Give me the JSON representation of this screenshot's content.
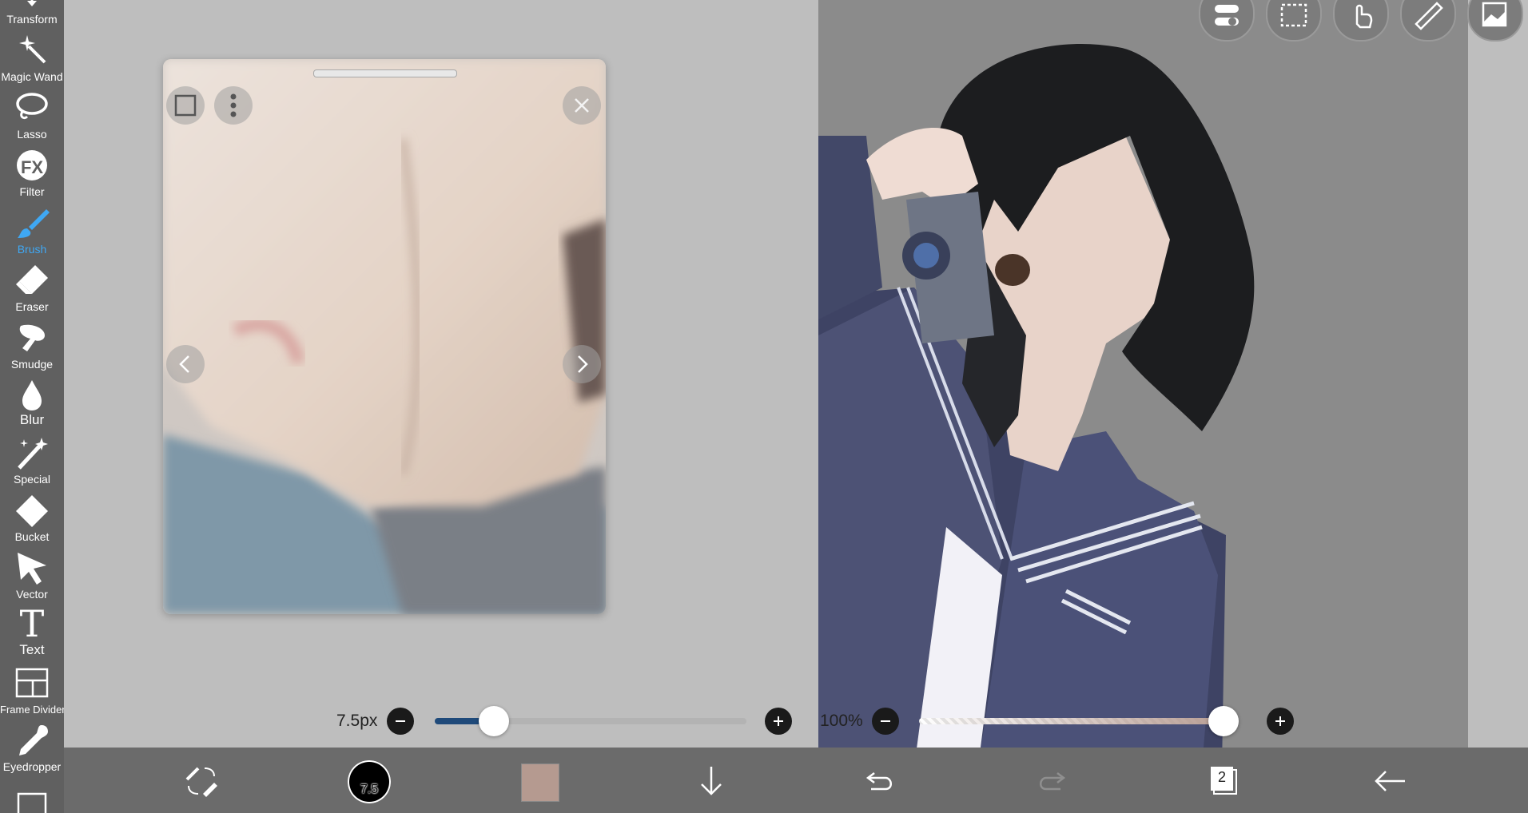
{
  "tools": [
    {
      "label": "Transform",
      "icon": "transform-icon"
    },
    {
      "label": "Magic Wand",
      "icon": "magic-wand-icon"
    },
    {
      "label": "Lasso",
      "icon": "lasso-icon"
    },
    {
      "label": "Filter",
      "icon": "filter-fx-icon"
    },
    {
      "label": "Brush",
      "icon": "brush-icon",
      "active": true
    },
    {
      "label": "Eraser",
      "icon": "eraser-icon"
    },
    {
      "label": "Smudge",
      "icon": "smudge-icon"
    },
    {
      "label": "Blur",
      "icon": "blur-icon"
    },
    {
      "label": "Special",
      "icon": "special-icon"
    },
    {
      "label": "Bucket",
      "icon": "bucket-icon"
    },
    {
      "label": "Vector",
      "icon": "vector-icon"
    },
    {
      "label": "Text",
      "icon": "text-icon"
    },
    {
      "label": "Frame Divider",
      "icon": "frame-divider-icon"
    },
    {
      "label": "Eyedropper",
      "icon": "eyedropper-icon"
    }
  ],
  "filter_glyph": "FX",
  "text_glyph": "T",
  "brush_size": {
    "label": "7.5px",
    "value_fraction": 0.19
  },
  "opacity": {
    "label": "100%",
    "value_fraction": 1.0
  },
  "bottom_bar": {
    "brush_badge": "7.5",
    "layer_count": "2",
    "current_color": "#b59a90"
  },
  "colors": {
    "accent": "#3fa8f4",
    "toolbar_bg": "#606060",
    "bottom_bar_bg": "#6b6b6b",
    "workspace_bg": "#bebebe",
    "canvas_bg": "#8b8b8b",
    "slider_fill": "#1f4a7a"
  }
}
